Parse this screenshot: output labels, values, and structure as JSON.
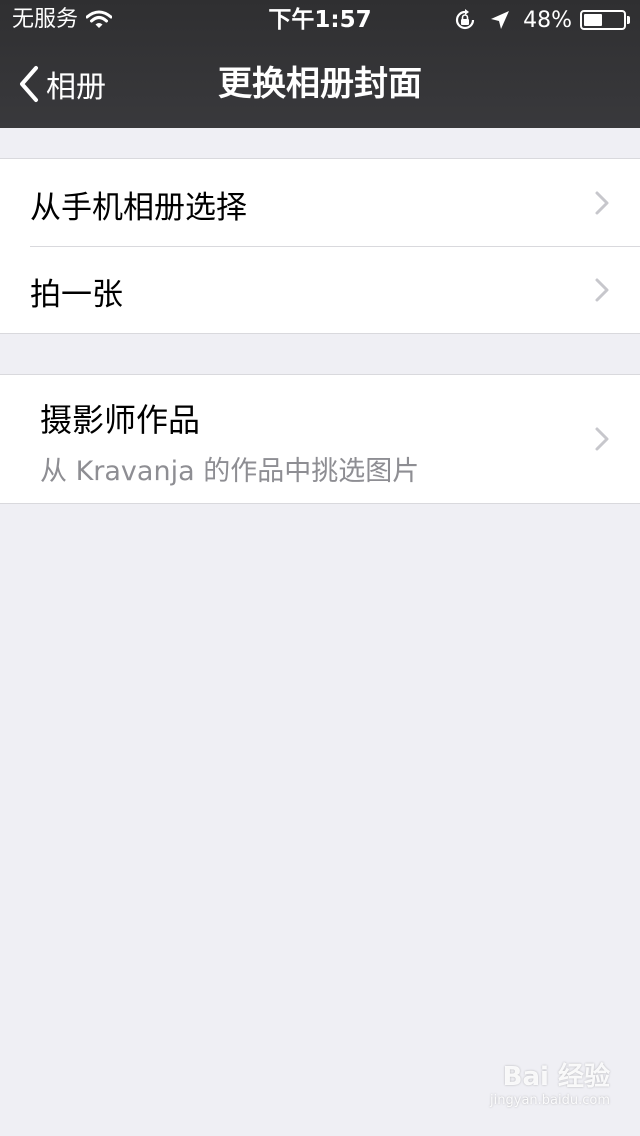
{
  "status_bar": {
    "carrier": "无服务",
    "time": "下午1:57",
    "battery_percent": "48%",
    "battery_level": 0.48,
    "icons": [
      "wifi-icon",
      "orientation-lock-icon",
      "location-arrow-icon",
      "battery-icon"
    ]
  },
  "nav": {
    "back_label": "相册",
    "title": "更换相册封面"
  },
  "menu": {
    "from_phone_album": "从手机相册选择",
    "take_photo": "拍一张"
  },
  "photographer": {
    "title": "摄影师作品",
    "subtitle": "从 Kravanja 的作品中挑选图片"
  },
  "watermark": {
    "logo": "Bai 经验",
    "url": "jingyan.baidu.com"
  },
  "colors": {
    "nav_background": "#333335",
    "page_background": "#efeff4",
    "cell_background": "#ffffff",
    "separator": "#d9d9dd",
    "chevron": "#c7c7cc",
    "subtitle": "#8e8e93"
  }
}
